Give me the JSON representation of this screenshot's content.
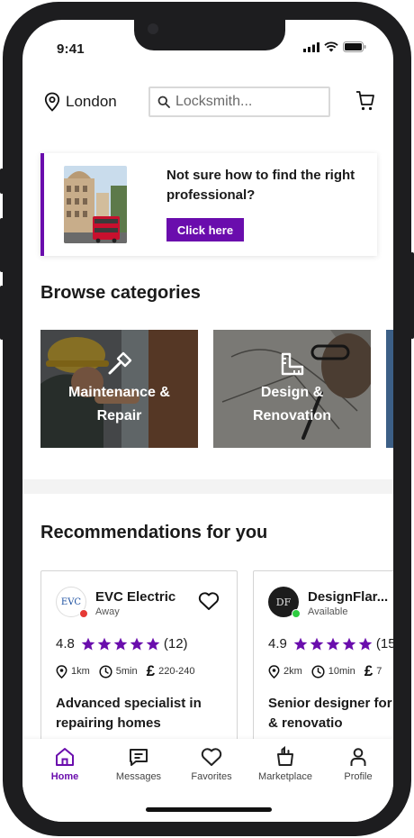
{
  "status_bar": {
    "time": "9:41"
  },
  "header": {
    "location": "London",
    "search_placeholder": "Locksmith..."
  },
  "banner": {
    "text": "Not sure how to find the right professional?",
    "button_label": "Click here"
  },
  "browse": {
    "title": "Browse categories",
    "categories": [
      {
        "line1": "Maintenance &",
        "line2": "Repair",
        "icon": "hammer-icon"
      },
      {
        "line1": "Design &",
        "line2": "Renovation",
        "icon": "ruler-icon"
      }
    ]
  },
  "recommendations": {
    "title": "Recommendations for you",
    "items": [
      {
        "name": "EVC Electric",
        "status": "Away",
        "status_color": "#e53935",
        "rating": "4.8",
        "reviews": "(12)",
        "distance": "1km",
        "time": "5min",
        "price": "220-240",
        "description": "Advanced specialist in repairing homes",
        "avatar_text": "EVC"
      },
      {
        "name": "DesignFlar...",
        "status": "Available",
        "status_color": "#2ecc40",
        "rating": "4.9",
        "reviews": "(15",
        "distance": "2km",
        "time": "10min",
        "price": "7",
        "description": "Senior designer for design & renovatio",
        "avatar_text": "DF"
      }
    ]
  },
  "tabbar": {
    "tabs": [
      {
        "label": "Home",
        "icon": "home-icon",
        "active": true
      },
      {
        "label": "Messages",
        "icon": "message-icon"
      },
      {
        "label": "Favorites",
        "icon": "heart-icon"
      },
      {
        "label": "Marketplace",
        "icon": "shopping-bag-icon"
      },
      {
        "label": "Profile",
        "icon": "user-icon"
      }
    ]
  },
  "colors": {
    "accent": "#6a0dad",
    "star": "#6a0dad",
    "frame": "#1d1d1f"
  }
}
